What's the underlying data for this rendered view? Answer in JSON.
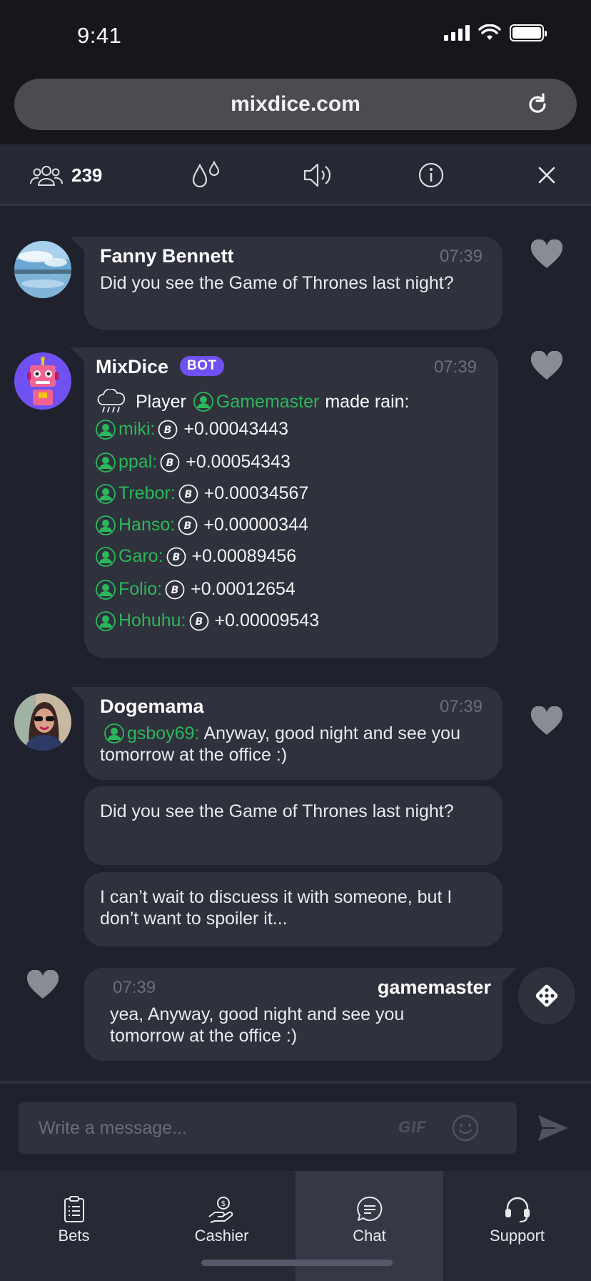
{
  "status_bar": {
    "time": "9:41"
  },
  "browser": {
    "url": "mixdice.com"
  },
  "toolbar": {
    "online_count": "239"
  },
  "messages": [
    {
      "name": "Fanny Bennett",
      "time": "07:39",
      "text": "Did you see the Game of Thrones last night?"
    },
    {
      "name": "MixDice",
      "badge": "BOT",
      "time": "07:39",
      "rain": {
        "prefix": "Player",
        "player": "Gamemaster",
        "suffix": "made rain:"
      },
      "recipients": [
        {
          "user": "miki:",
          "amount": "+0.00043443"
        },
        {
          "user": "ppal:",
          "amount": "+0.00054343"
        },
        {
          "user": "Trebor:",
          "amount": "+0.00034567"
        },
        {
          "user": "Hanso:",
          "amount": "+0.00000344"
        },
        {
          "user": "Garo:",
          "amount": "+0.00089456"
        },
        {
          "user": "Folio:",
          "amount": "+0.00012654"
        },
        {
          "user": "Hohuhu:",
          "amount": "+0.00009543"
        }
      ]
    },
    {
      "name": "Dogemama",
      "time": "07:39",
      "mention": "gsboy69:",
      "text_line1": "Anyway, good night and see you",
      "text_line2": "tomorrow at the office :)",
      "followups": [
        "Did you see the Game of Thrones last night?",
        "I can’t wait to discuess it with someone, but I",
        "don’t want to spoiler it..."
      ]
    },
    {
      "name": "gamemaster",
      "time": "07:39",
      "text_line1": "yea, Anyway, good night and see you",
      "text_line2": "tomorrow at the office :)"
    }
  ],
  "composer": {
    "placeholder": "Write a message...",
    "gif_label": "GIF"
  },
  "nav": {
    "items": [
      {
        "label": "Bets"
      },
      {
        "label": "Cashier"
      },
      {
        "label": "Chat"
      },
      {
        "label": "Support"
      }
    ],
    "active": "Chat"
  },
  "colors": {
    "accent_green": "#2bb75b",
    "bot_badge": "#6f50f0",
    "bubble": "#2f313c",
    "background": "#1f222c"
  }
}
